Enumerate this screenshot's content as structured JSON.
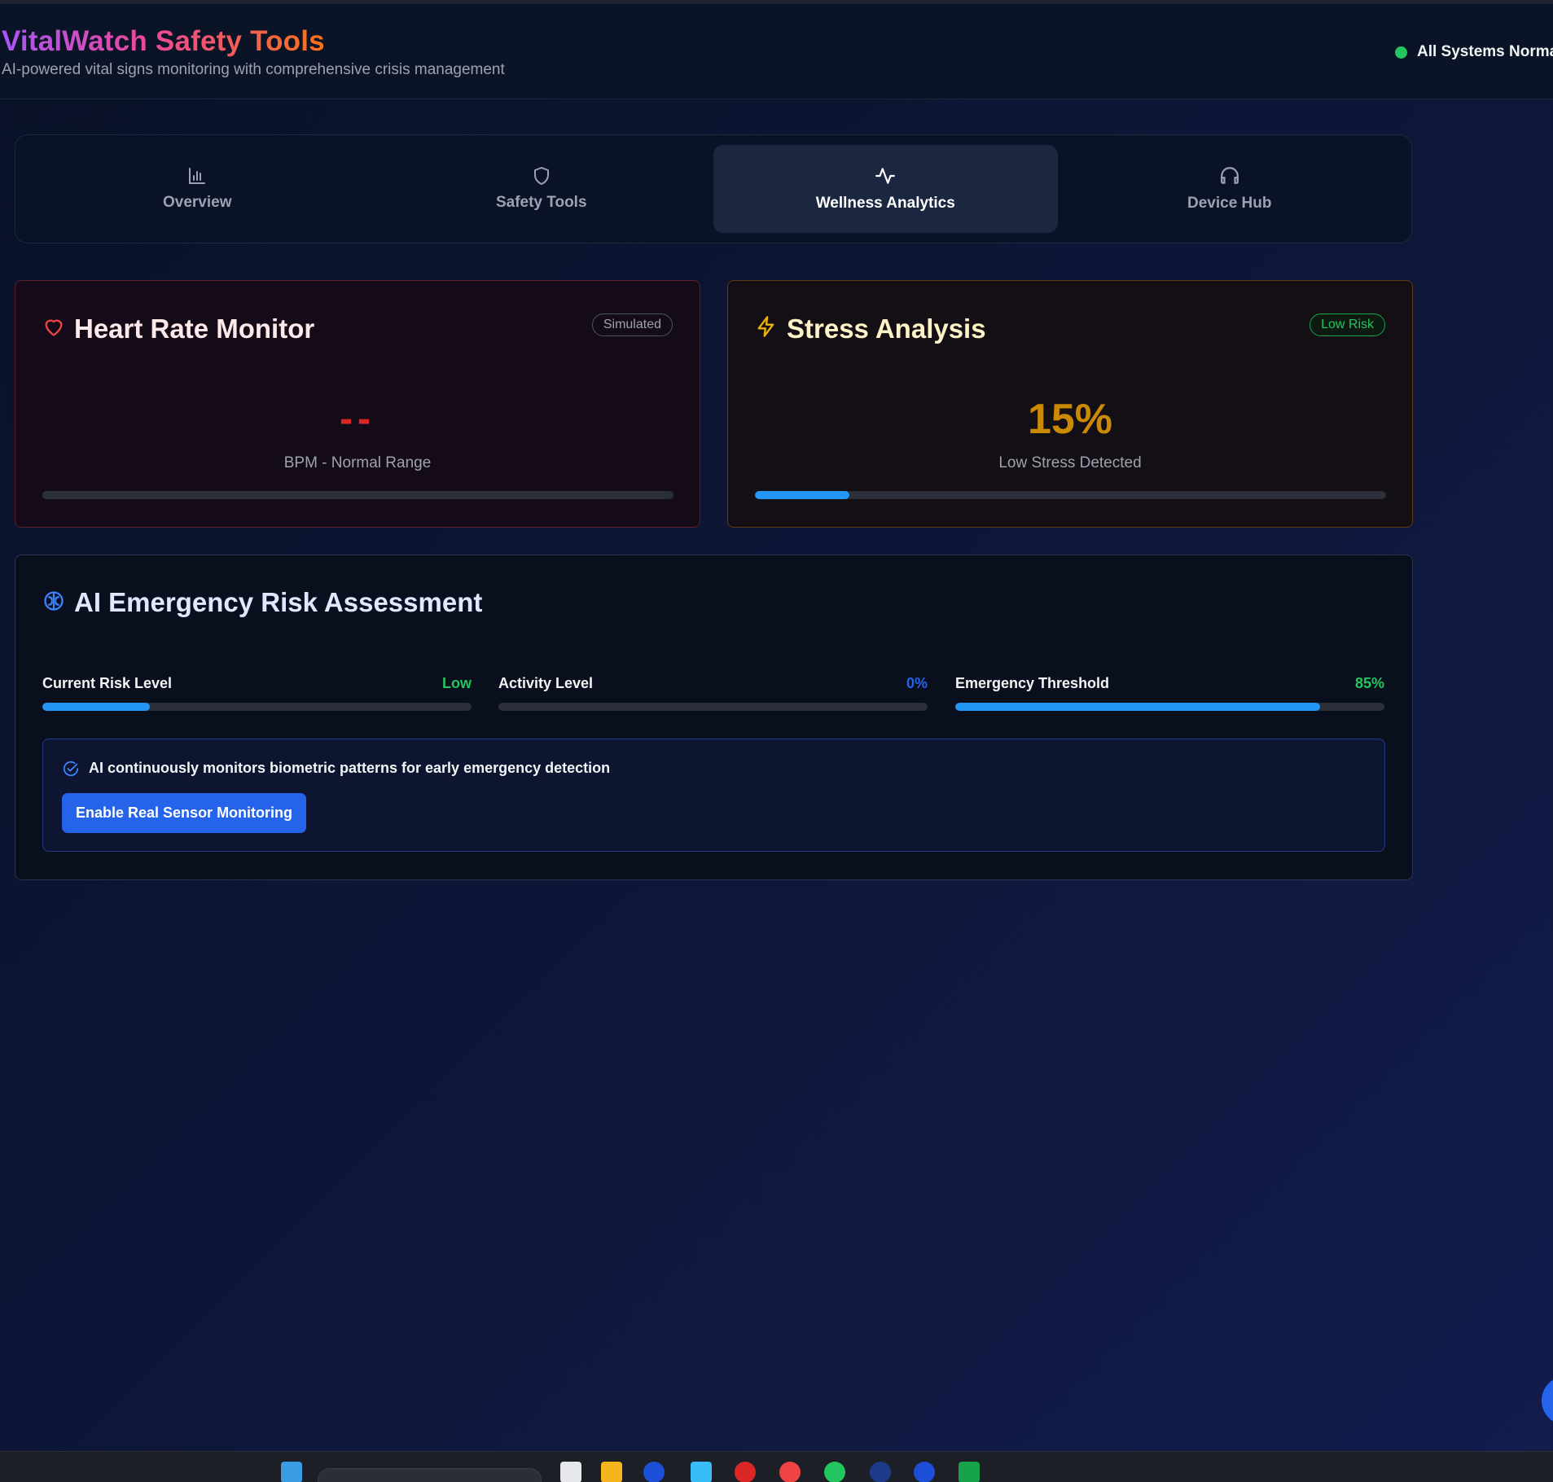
{
  "app": {
    "title": "VitalWatch Safety Tools",
    "subtitle": "AI-powered vital signs monitoring with comprehensive crisis management",
    "status_text": "All Systems Normal",
    "status_color": "#22c55e"
  },
  "tabs": [
    {
      "label": "Overview",
      "icon": "bar-chart-icon",
      "active": false
    },
    {
      "label": "Safety Tools",
      "icon": "shield-icon",
      "active": false
    },
    {
      "label": "Wellness Analytics",
      "icon": "activity-icon",
      "active": true
    },
    {
      "label": "Device Hub",
      "icon": "headphones-icon",
      "active": false
    }
  ],
  "heart_rate": {
    "title": "Heart Rate Monitor",
    "badge": "Simulated",
    "value": "--",
    "caption": "BPM - Normal Range",
    "progress": 0
  },
  "stress": {
    "title": "Stress Analysis",
    "badge": "Low Risk",
    "value": "15%",
    "caption": "Low Stress Detected",
    "progress": 0.15
  },
  "risk": {
    "title": "AI Emergency Risk Assessment",
    "metrics": [
      {
        "label": "Current Risk Level",
        "value": "Low",
        "value_color": "#22c55e",
        "progress": 0.25
      },
      {
        "label": "Activity Level",
        "value": "0%",
        "value_color": "#2563eb",
        "progress": 0
      },
      {
        "label": "Emergency Threshold",
        "value": "85%",
        "value_color": "#22c55e",
        "progress": 0.85
      }
    ],
    "note": "AI continuously monitors biometric patterns for early emergency detection",
    "button_label": "Enable Real Sensor Monitoring"
  },
  "colors": {
    "accent": "#2563eb",
    "progress": "#2196f3",
    "heart": "#dc2626",
    "stress": "#ca8a04"
  }
}
